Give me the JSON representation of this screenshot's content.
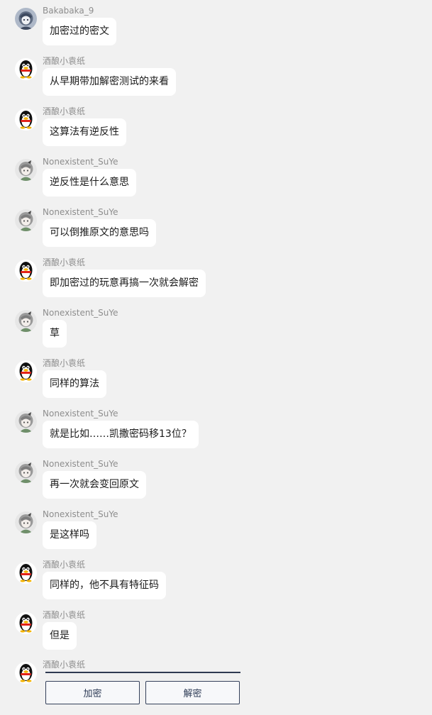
{
  "messages": [
    {
      "sender": "Bakabaka_9",
      "avatar": "anime-avatar-icon",
      "text": "加密过的密文"
    },
    {
      "sender": "酒酿小袁纸",
      "avatar": "qq-penguin-icon",
      "text": "从早期带加解密测试的来看"
    },
    {
      "sender": "酒酿小袁纸",
      "avatar": "qq-penguin-icon",
      "text": "这算法有逆反性"
    },
    {
      "sender": "Nonexistent_SuYe",
      "avatar": "gray-anime-avatar-icon",
      "text": "逆反性是什么意思"
    },
    {
      "sender": "Nonexistent_SuYe",
      "avatar": "gray-anime-avatar-icon",
      "text": "可以倒推原文的意思吗"
    },
    {
      "sender": "酒酿小袁纸",
      "avatar": "qq-penguin-icon",
      "text": "即加密过的玩意再搞一次就会解密"
    },
    {
      "sender": "Nonexistent_SuYe",
      "avatar": "gray-anime-avatar-icon",
      "text": "草"
    },
    {
      "sender": "酒酿小袁纸",
      "avatar": "qq-penguin-icon",
      "text": "同样的算法"
    },
    {
      "sender": "Nonexistent_SuYe",
      "avatar": "gray-anime-avatar-icon",
      "text": "就是比如……凯撒密码移13位？"
    },
    {
      "sender": "Nonexistent_SuYe",
      "avatar": "gray-anime-avatar-icon",
      "text": "再一次就会变回原文"
    },
    {
      "sender": "Nonexistent_SuYe",
      "avatar": "gray-anime-avatar-icon",
      "text": "是这样吗"
    },
    {
      "sender": "酒酿小袁纸",
      "avatar": "qq-penguin-icon",
      "text": "同样的，他不具有特征码"
    },
    {
      "sender": "酒酿小袁纸",
      "avatar": "qq-penguin-icon",
      "text": "但是"
    }
  ],
  "last_sender": "酒酿小袁纸",
  "last_avatar": "qq-penguin-icon",
  "buttons": {
    "encrypt_label": "加密",
    "decrypt_label": "解密"
  },
  "colors": {
    "background": "#f1f1f1",
    "bubble": "#ffffff",
    "sender_name": "#8e8e8e",
    "button_border": "#34405a"
  }
}
